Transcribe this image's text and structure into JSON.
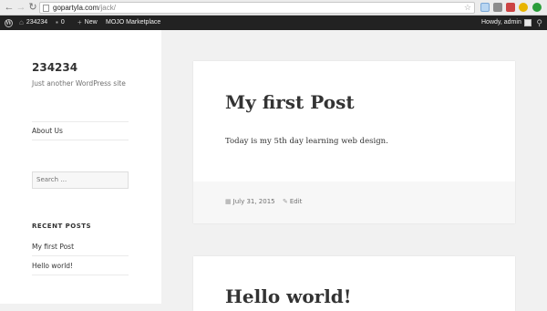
{
  "browser": {
    "url_host": "gopartyla.com",
    "url_path": "/jack/"
  },
  "admin_bar": {
    "site_name": "234234",
    "comments_count": "0",
    "new_label": "New",
    "mojo_label": "MOJO Marketplace",
    "howdy_label": "Howdy, admin"
  },
  "sidebar": {
    "site_title": "234234",
    "site_description": "Just another WordPress site",
    "menu": [
      {
        "label": "About Us"
      }
    ],
    "search_placeholder": "Search …",
    "recent_heading": "RECENT POSTS",
    "recent_posts": [
      {
        "label": "My first Post"
      },
      {
        "label": "Hello world!"
      }
    ]
  },
  "posts": [
    {
      "title": "My first Post",
      "body": "Today is my 5th day learning web design.",
      "date": "July 31, 2015",
      "edit_label": "Edit"
    },
    {
      "title": "Hello world!"
    }
  ]
}
